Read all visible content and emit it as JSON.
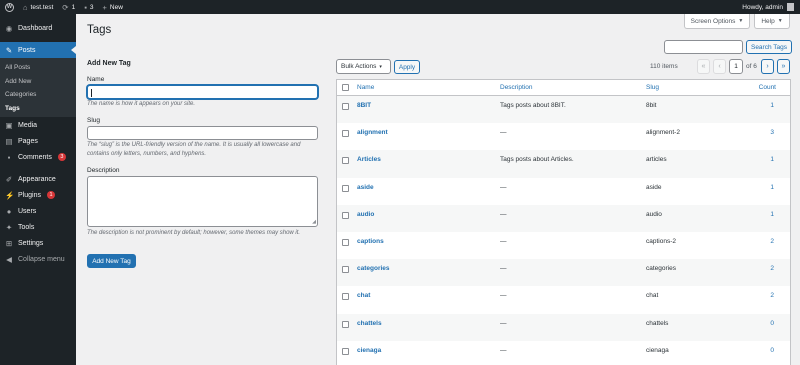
{
  "adminbar": {
    "site_name": "test.test",
    "updates_count": "1",
    "comments_count": "3",
    "new_label": "New",
    "howdy": "Howdy, admin"
  },
  "sidebar": {
    "dashboard": "Dashboard",
    "posts": "Posts",
    "submenu": [
      "All Posts",
      "Add New",
      "Categories",
      "Tags"
    ],
    "media": "Media",
    "pages": "Pages",
    "comments": "Comments",
    "comments_badge": "3",
    "appearance": "Appearance",
    "plugins": "Plugins",
    "plugins_badge": "1",
    "users": "Users",
    "tools": "Tools",
    "settings": "Settings",
    "collapse": "Collapse menu"
  },
  "screen_options": {
    "label": "Screen Options"
  },
  "help": {
    "label": "Help"
  },
  "page_title": "Tags",
  "search": {
    "button": "Search Tags",
    "value": ""
  },
  "form": {
    "title": "Add New Tag",
    "name_label": "Name",
    "name_help": "The name is how it appears on your site.",
    "slug_label": "Slug",
    "slug_help": "The “slug” is the URL-friendly version of the name. It is usually all lowercase and contains only letters, numbers, and hyphens.",
    "description_label": "Description",
    "description_help": "The description is not prominent by default; however, some themes may show it.",
    "submit": "Add New Tag"
  },
  "tablenav": {
    "bulk_actions": "Bulk Actions",
    "apply": "Apply",
    "items": "110 items",
    "first": "«",
    "prev": "‹",
    "current_page": "1",
    "of_pages": "of 6",
    "next": "›",
    "last": "»"
  },
  "table": {
    "headers": {
      "name": "Name",
      "description": "Description",
      "slug": "Slug",
      "count": "Count"
    },
    "rows": [
      {
        "name": "8BIT",
        "description": "Tags posts about 8BIT.",
        "slug": "8bit",
        "count": "1"
      },
      {
        "name": "alignment",
        "description": "—",
        "slug": "alignment-2",
        "count": "3"
      },
      {
        "name": "Articles",
        "description": "Tags posts about Articles.",
        "slug": "articles",
        "count": "1"
      },
      {
        "name": "aside",
        "description": "—",
        "slug": "aside",
        "count": "1"
      },
      {
        "name": "audio",
        "description": "—",
        "slug": "audio",
        "count": "1"
      },
      {
        "name": "captions",
        "description": "—",
        "slug": "captions-2",
        "count": "2"
      },
      {
        "name": "categories",
        "description": "—",
        "slug": "categories",
        "count": "2"
      },
      {
        "name": "chat",
        "description": "—",
        "slug": "chat",
        "count": "2"
      },
      {
        "name": "chattels",
        "description": "—",
        "slug": "chattels",
        "count": "0"
      },
      {
        "name": "cienaga",
        "description": "—",
        "slug": "cienaga",
        "count": "0"
      }
    ]
  },
  "colors": {
    "admin_dark": "#1d2327",
    "accent": "#2271b1",
    "badge": "#d63638",
    "background": "#f0f0f1"
  }
}
